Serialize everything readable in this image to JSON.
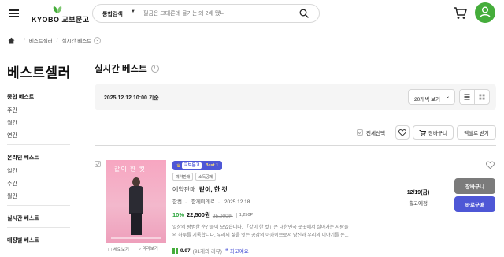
{
  "header": {
    "logo_text": "KYOBO 교보문고",
    "search_category": "통합검색",
    "search_placeholder": "필금은 그대론데 물가는 왜 2배 됐니",
    "brand_color": "#45ad3b"
  },
  "breadcrumb": {
    "items": [
      "베스트셀러",
      "실시간 베스트"
    ]
  },
  "sidebar": {
    "title": "베스트셀러",
    "sections": [
      {
        "label": "종합 베스트",
        "items": [
          "주간",
          "월간",
          "연간"
        ]
      },
      {
        "label": "온라인 베스트",
        "items": [
          "일간",
          "주간",
          "월간"
        ]
      },
      {
        "label": "실시간 베스트",
        "items": []
      },
      {
        "label": "매장별 베스트",
        "items": []
      }
    ]
  },
  "main": {
    "title": "실시간 베스트",
    "info_icon": "!",
    "date_label": "2025.12.12 10:00 기준",
    "per_page": "20개씩 보기",
    "select_all": "전체선택",
    "cart_button": "장바구니",
    "excel_button": "엑셀로 받기"
  },
  "product": {
    "badge_prefix": "교보문고",
    "badge_rank": "Best 1",
    "tags": [
      "예약판매",
      "소득공제"
    ],
    "title_prefix": "예약판매",
    "title": "같이, 한 컷",
    "author": "한컷",
    "publisher": "함께미래로",
    "date": "2025.12.18",
    "discount": "10%",
    "price": "22,500원",
    "original_price": "25,000원",
    "points": "1,250P",
    "description_lines": [
      "일상의 평범한 순간들이 모였습니다. 「같이 한 컷」은 대한민국 곳곳에서 살아가는 사람들",
      "의 하루를 기록합니다. 우리의 삶을 잇는 공감의 아카이브로서 당신과 우리의 이야기를 돈..."
    ],
    "rating": "9.97",
    "review_count": "(91개의 리뷰)",
    "review_quote": "❝",
    "review_keyword": "최고예요",
    "cover_title": "같이 한 컷",
    "preview_labels": [
      "세로보기",
      "미리보기"
    ],
    "ship_date": "12/19(금)",
    "ship_status": "출고예정",
    "cart_btn": "장바구니",
    "buy_btn": "바로구매",
    "accent_color": "#4e57d6",
    "discount_color": "#2aa53b"
  }
}
